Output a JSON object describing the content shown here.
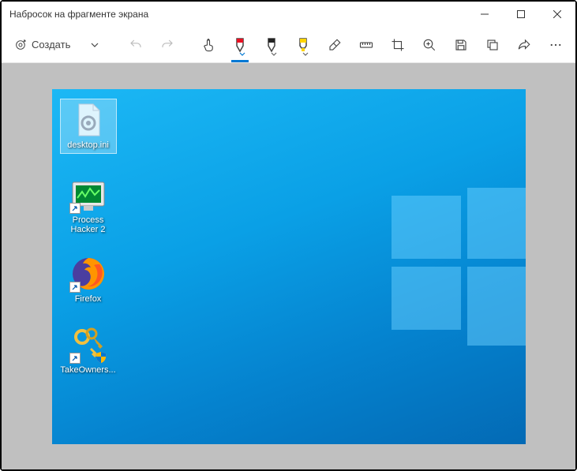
{
  "window": {
    "title": "Набросок на фрагменте экрана"
  },
  "toolbar": {
    "new_label": "Создать"
  },
  "desktop": {
    "icons": [
      {
        "label": "desktop.ini"
      },
      {
        "label": "Process Hacker 2"
      },
      {
        "label": "Firefox"
      },
      {
        "label": "TakeOwners..."
      }
    ]
  }
}
